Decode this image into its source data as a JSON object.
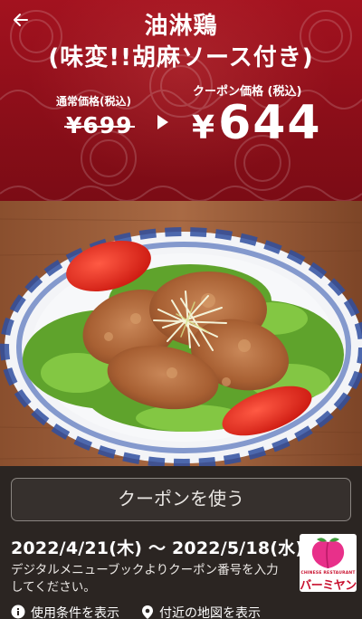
{
  "header": {
    "back_icon": "arrow-left-icon",
    "title_line1": "油淋鶏",
    "title_line2": "(味変!!胡麻ソース付き)",
    "regular_label": "通常価格(税込)",
    "regular_price": "¥699",
    "coupon_label": "クーポン価格 (税込)",
    "coupon_currency": "¥",
    "coupon_price": "644",
    "brand_color": "#9b111e"
  },
  "coupon": {
    "use_button_label": "クーポンを使う",
    "validity_period": "2022/4/21(木) 〜 2022/5/18(水)",
    "note": "デジタルメニューブックよりクーポン番号を入力してください。"
  },
  "brand": {
    "logo_caption": "CHINESE RESTAURANT",
    "logo_name": "バーミヤン",
    "logo_color": "#c8102e"
  },
  "links": {
    "terms_label": "使用条件を表示",
    "terms_icon": "info-icon",
    "map_label": "付近の地図を表示",
    "map_icon": "location-pin-icon"
  }
}
